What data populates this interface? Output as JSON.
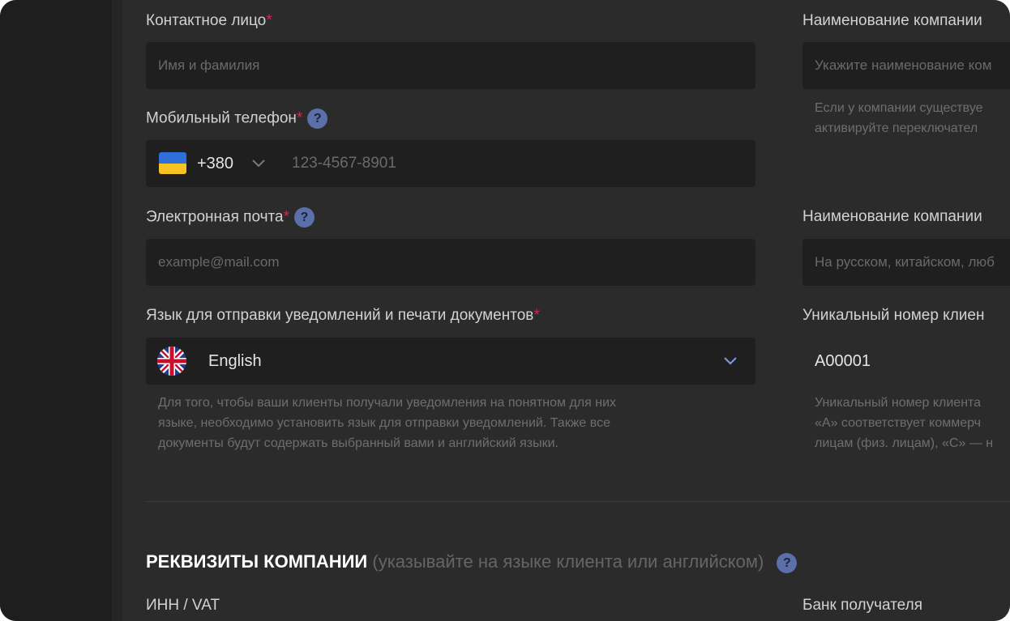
{
  "left": {
    "contact": {
      "label": "Контактное лицо",
      "required": "*",
      "placeholder": "Имя и фамилия"
    },
    "phone": {
      "label": "Мобильный телефон",
      "required": "*",
      "help": "?",
      "code": "+380",
      "placeholder": "123-4567-8901"
    },
    "email": {
      "label": "Электронная почта",
      "required": "*",
      "help": "?",
      "placeholder": "example@mail.com"
    },
    "language": {
      "label": "Язык для отправки уведомлений и печати документов",
      "required": "*",
      "value": "English",
      "hint": [
        "Для того, чтобы ваши клиенты получали уведомления на понятном для них",
        "языке, необходимо установить язык для отправки уведомлений. Также все",
        "документы будут содержать выбранный вами и английский языки."
      ]
    }
  },
  "right": {
    "company_name": {
      "label": "Наименование компании",
      "placeholder": "Укажите наименование ком",
      "hint": [
        "Если у компании существуе",
        "активируйте переключател"
      ]
    },
    "company_name_2": {
      "label": "Наименование компании",
      "placeholder": "На русском, китайском, люб"
    },
    "client_id": {
      "label": "Уникальный номер клиен",
      "value": "A00001",
      "hint": [
        "Уникальный номер клиента",
        "«А» соответствует коммерч",
        "лицам (физ. лицам), «С» — н"
      ]
    }
  },
  "section": {
    "title": "РЕКВИЗИТЫ КОМПАНИИ",
    "subtitle": " (указывайте на языке клиента или английском)",
    "help": "?"
  },
  "bottom": {
    "inn_label": "ИНН / VAT",
    "bank_label": "Банк получателя"
  },
  "colors": {
    "background": "#2b2b2b",
    "field": "#1f1f1f",
    "required": "#d6254d",
    "help_badge": "#5b6fa8",
    "accent_chevron": "#7b96d8"
  }
}
